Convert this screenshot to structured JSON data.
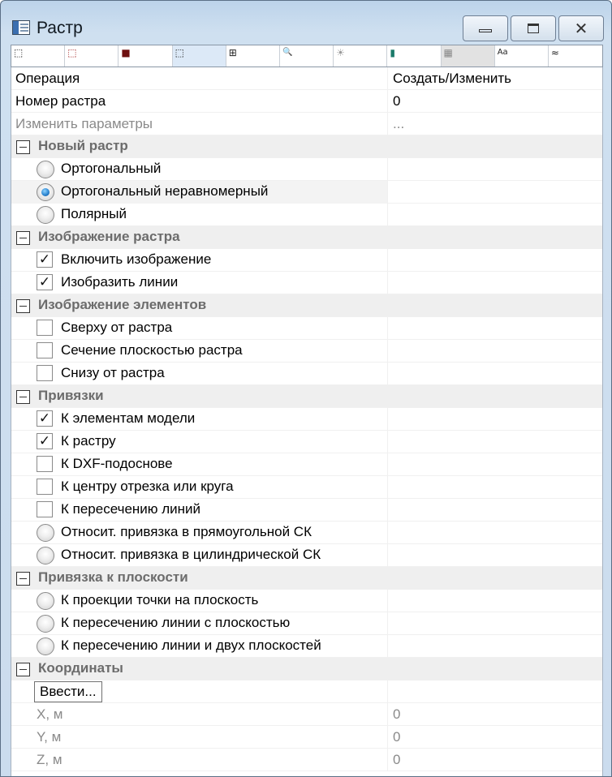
{
  "window": {
    "title": "Растр"
  },
  "toolbar": {
    "icons": [
      "cube-outline-icon",
      "cube-red-outline-icon",
      "cube-dark-red-icon",
      "cube-grid-icon",
      "grid-snap-icon",
      "magnify-icon",
      "lightbulb-icon",
      "database-icon",
      "layer-grid-icon",
      "font-size-icon",
      "text-style-icon"
    ],
    "glyphs": [
      "⬚",
      "⬚",
      "■",
      "⬚",
      "⊞",
      "🔍",
      "☀",
      "▮",
      "▦",
      "Aa",
      "≈"
    ]
  },
  "props": {
    "operation": {
      "label": "Операция",
      "value": "Создать/Изменить"
    },
    "number": {
      "label": "Номер растра",
      "value": "0"
    },
    "params": {
      "label": "Изменить параметры",
      "value": "..."
    }
  },
  "groups": {
    "new_raster": {
      "title": "Новый растр",
      "options": [
        "Ортогональный",
        "Ортогональный неравномерный",
        "Полярный"
      ],
      "selected": 1
    },
    "display": {
      "title": "Изображение растра",
      "options": [
        "Включить изображение",
        "Изобразить линии"
      ],
      "checked": [
        true,
        true
      ]
    },
    "elements": {
      "title": "Изображение элементов",
      "options": [
        "Сверху от растра",
        "Сечение плоскостью растра",
        "Снизу от растра"
      ],
      "checked": [
        false,
        false,
        false
      ]
    },
    "snaps": {
      "title": "Привязки",
      "checks": [
        "К элементам модели",
        "К растру",
        "К DXF-подоснове",
        "К центру отрезка или круга",
        "К пересечению линий"
      ],
      "checked": [
        true,
        true,
        false,
        false,
        false
      ],
      "radios": [
        "Относит. привязка в прямоугольной СК",
        "Относит. привязка в цилиндрической СК"
      ]
    },
    "plane_snap": {
      "title": "Привязка к плоскости",
      "radios": [
        "К проекции точки на плоскость",
        "К пересечению линии с плоскостью",
        "К пересечению линии и двух плоскостей"
      ]
    },
    "coords": {
      "title": "Координаты",
      "enter_label": "Ввести...",
      "fields": [
        {
          "label": "X, м",
          "value": "0"
        },
        {
          "label": "Y, м",
          "value": "0"
        },
        {
          "label": "Z, м",
          "value": "0"
        }
      ]
    }
  },
  "colors": {
    "category_bg": "#efefef",
    "category_text": "#6c6c6c",
    "muted_text": "#8a8a8a",
    "radio_selected": "#2d86d1"
  }
}
